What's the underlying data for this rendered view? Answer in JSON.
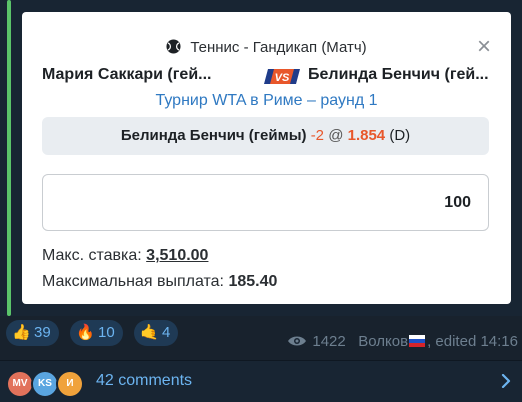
{
  "bet_card": {
    "sport_line": "Теннис - Гандикап (Матч)",
    "team1": "Мария Саккари (гей...",
    "vs_badge": "VS",
    "team2": "Белинда Бенчич (гей...",
    "tournament": "Турнир WTA в Риме – раунд 1",
    "selection": {
      "name": "Белинда Бенчич (геймы)",
      "handicap": "-2",
      "at": "@",
      "odds": "1.854",
      "suffix": "(D)"
    },
    "stake_value": "100",
    "max_stake_label": "Макс. ставка:",
    "max_stake_value": "3,510.00",
    "max_payout_label": "Максимальная выплата:",
    "max_payout_value": "185.40",
    "close_glyph": "×"
  },
  "reactions": [
    {
      "icon": "thumbs-up-icon",
      "emoji": "👍",
      "count": "39"
    },
    {
      "icon": "fire-icon",
      "emoji": "🔥",
      "count": "10"
    },
    {
      "icon": "hand-icon",
      "emoji": "🤙",
      "count": "4"
    }
  ],
  "meta": {
    "views": "1422",
    "author": "Волков",
    "edited": ", edited 14:16"
  },
  "comments": {
    "avatars": [
      {
        "initials": "MV",
        "color": "#e2725b"
      },
      {
        "initials": "KS",
        "color": "#5aa5e0"
      },
      {
        "initials": "И",
        "color": "#f0a23b"
      }
    ],
    "label": "42 comments"
  },
  "colors": {
    "accent_green": "#5bc46a",
    "link_blue": "#2f79c2",
    "odds_orange": "#e8572b"
  }
}
